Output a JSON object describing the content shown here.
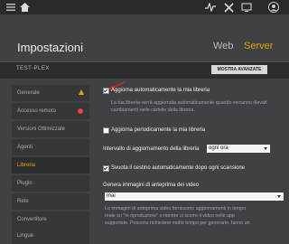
{
  "header": {
    "title": "Impostazioni",
    "tab_web": "Web",
    "tab_server": "Server",
    "accent": "#e5a00d"
  },
  "server": {
    "name": "TEST-PLEX",
    "advanced_button": "MOSTRA AVANZATE"
  },
  "sidebar": {
    "items": [
      {
        "label": "Generale",
        "status": "warning"
      },
      {
        "label": "Accesso remoto",
        "status": "error"
      },
      {
        "label": "Versioni Ottimizzate"
      },
      {
        "label": "Agenti"
      },
      {
        "label": "Libreria",
        "active": true
      },
      {
        "label": "Plugin"
      },
      {
        "label": "Rete"
      },
      {
        "label": "Convertitore"
      },
      {
        "label": "Lingue"
      }
    ]
  },
  "library": {
    "auto_update_label": "Aggiorna automaticamente la mia libreria",
    "auto_update_help": "La tua libreria verrà aggiornata automaticamente quando verranno rilevati cambiamenti nelle cartelle della libreria.",
    "periodic_update_label": "Aggiorna periodicamente la mia libreria",
    "interval_label": "Intervallo di aggiornamento della libreria",
    "interval_value": "ogni ora",
    "empty_trash_label": "Svuota il cestino automaticamente dopo ogni scansione",
    "thumbnails_label": "Genera immagini di anteprima dei video",
    "thumbnails_value": "mai",
    "thumbnails_help_1": "Le immagini di anteprima video forniscono aggiornamenti in tempo",
    "thumbnails_help_2": "reale su \"In riproduzione\" e mentre si scorre il video nelle app",
    "thumbnails_help_3": "supportate. Possono richiedere molto tempo per generarle, fanno un"
  }
}
